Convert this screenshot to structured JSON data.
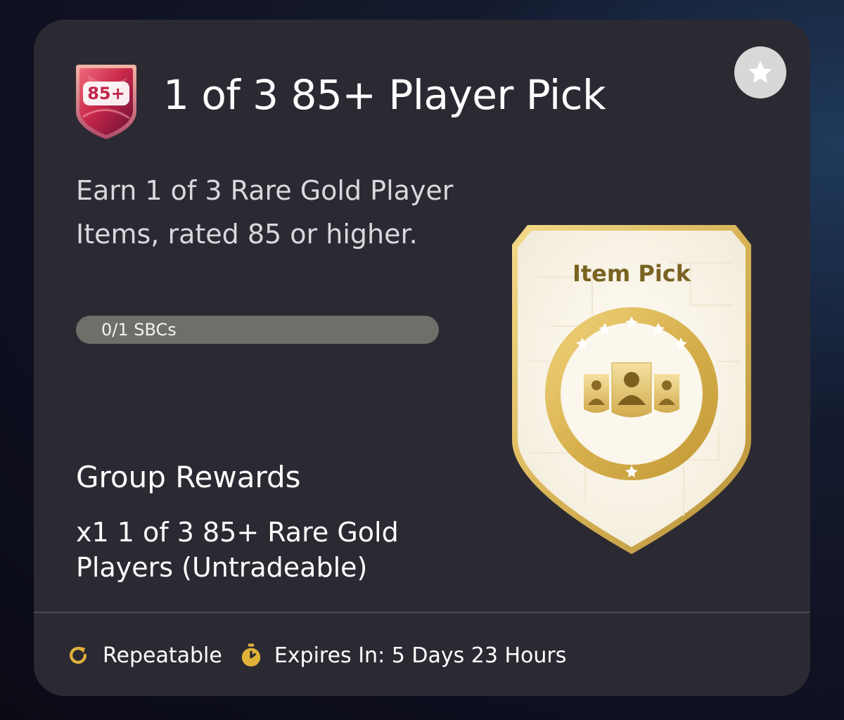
{
  "header": {
    "badge_text": "85+",
    "title": "1 of 3 85+ Player Pick",
    "favorite_icon": "star-icon"
  },
  "description": "Earn 1 of 3 Rare Gold Player Items, rated 85 or higher.",
  "progress": {
    "label": "0/1 SBCs",
    "completed": 0,
    "total": 1
  },
  "rewards": {
    "heading": "Group Rewards",
    "text": "x1 1 of 3 85+ Rare Gold Players (Untradeable)"
  },
  "item_card": {
    "label": "Item Pick",
    "icon": "player-pick-icon"
  },
  "footer": {
    "repeatable_label": "Repeatable",
    "repeatable_icon": "repeat-icon",
    "expiry_label": "Expires In: 5 Days 23 Hours",
    "expiry_icon": "timer-icon"
  },
  "colors": {
    "card_background": "#2b2a33",
    "accent_gold": "#e0b23a",
    "progress_track": "#6f6e69"
  }
}
